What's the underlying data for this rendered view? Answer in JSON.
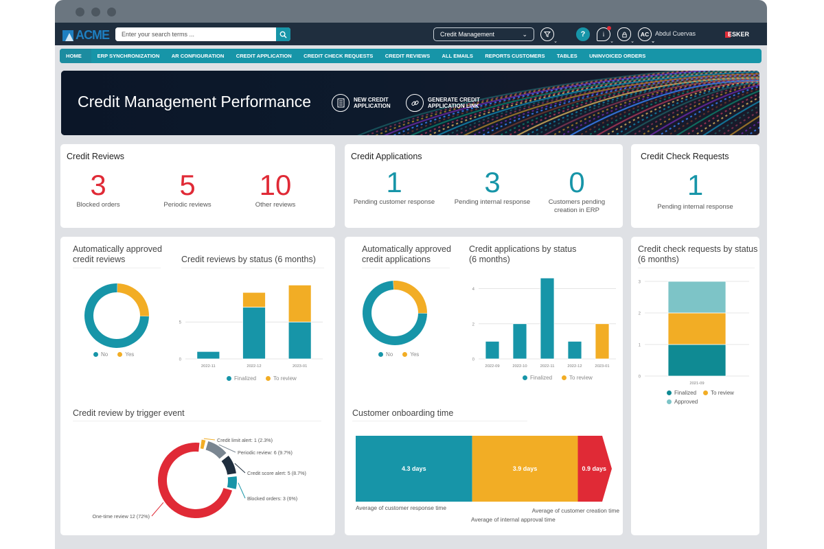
{
  "window": {
    "controls": [
      "close",
      "minimize",
      "maximize"
    ]
  },
  "topbar": {
    "logo_text": "ACME",
    "search": {
      "placeholder": "Enter your search terms ...",
      "value": ""
    },
    "module_select": {
      "selected": "Credit Management"
    },
    "user": {
      "initials": "AC",
      "name": "Abdul Cuervas"
    },
    "brand": "ESKER",
    "help_label": "?"
  },
  "nav": {
    "items": [
      {
        "label": "HOME",
        "active": true
      },
      {
        "label": "ERP SYNCHRONIZATION"
      },
      {
        "label": "AR CONFIGURATION"
      },
      {
        "label": "CREDIT APPLICATION"
      },
      {
        "label": "CREDIT CHECK REQUESTS"
      },
      {
        "label": "CREDIT REVIEWS"
      },
      {
        "label": "ALL EMAILS"
      },
      {
        "label": "REPORTS CUSTOMERS"
      },
      {
        "label": "TABLES"
      },
      {
        "label": "UNINVOICED ORDERS"
      }
    ]
  },
  "hero": {
    "title": "Credit Management Performance",
    "actions": [
      {
        "label_line1": "NEW CREDIT",
        "label_line2": "APPLICATION"
      },
      {
        "label_line1": "GENERATE CREDIT",
        "label_line2": "APPLICATION LINK"
      }
    ]
  },
  "colors": {
    "teal": "#1795a8",
    "red": "#e02a36",
    "yellow": "#f2ad25",
    "light_teal": "#7dc4c7",
    "dark": "#1f2e3e",
    "grey": "#7a8691"
  },
  "kpis": {
    "credit_reviews": {
      "title": "Credit Reviews",
      "items": [
        {
          "value": "3",
          "label": "Blocked orders"
        },
        {
          "value": "5",
          "label": "Periodic reviews"
        },
        {
          "value": "10",
          "label": "Other reviews"
        }
      ]
    },
    "credit_applications": {
      "title": "Credit Applications",
      "items": [
        {
          "value": "1",
          "label": "Pending customer response"
        },
        {
          "value": "3",
          "label": "Pending internal response"
        },
        {
          "value": "0",
          "label": "Customers pending creation in ERP"
        }
      ]
    },
    "credit_check_requests": {
      "title": "Credit Check Requests",
      "items": [
        {
          "value": "1",
          "label": "Pending internal response"
        }
      ]
    }
  },
  "chart_data": [
    {
      "id": "auto_approved_reviews",
      "type": "pie",
      "title": "Automatically approved credit reviews",
      "categories": [
        "No",
        "Yes"
      ],
      "values": [
        75,
        25
      ],
      "donut": true,
      "legend": "bottom"
    },
    {
      "id": "reviews_by_status",
      "type": "bar",
      "stacked": true,
      "title": "Credit reviews by status (6 months)",
      "categories": [
        "2022-11",
        "2022-12",
        "2023-01"
      ],
      "series": [
        {
          "name": "Finalized",
          "values": [
            1,
            7,
            5
          ]
        },
        {
          "name": "To review",
          "values": [
            0,
            2,
            5
          ]
        }
      ],
      "yticks": [
        0,
        5
      ],
      "ylim": [
        0,
        10.5
      ],
      "grid": true,
      "legend": "bottom"
    },
    {
      "id": "auto_approved_applications",
      "type": "pie",
      "title": "Automatically approved credit applications",
      "categories": [
        "No",
        "Yes"
      ],
      "values": [
        74,
        26
      ],
      "donut": true,
      "legend": "bottom"
    },
    {
      "id": "applications_by_status",
      "type": "bar",
      "stacked": true,
      "title": "Credit applications by status (6 months)",
      "categories": [
        "2022-09",
        "2022-10",
        "2022-11",
        "2022-12",
        "2023-01"
      ],
      "series": [
        {
          "name": "Finalized",
          "values": [
            1,
            2,
            4.6,
            1,
            0
          ]
        },
        {
          "name": "To review",
          "values": [
            0,
            0,
            0,
            0,
            2
          ]
        }
      ],
      "yticks": [
        0,
        2,
        4
      ],
      "ylim": [
        0,
        4.8
      ],
      "grid": true,
      "legend": "bottom"
    },
    {
      "id": "check_requests_by_status",
      "type": "bar",
      "stacked": true,
      "title": "Credit check requests by status (6 months)",
      "categories": [
        "2021-09"
      ],
      "series": [
        {
          "name": "Finalized",
          "values": [
            1
          ]
        },
        {
          "name": "To review",
          "values": [
            1
          ]
        },
        {
          "name": "Approved",
          "values": [
            1
          ]
        }
      ],
      "yticks": [
        0,
        1,
        2,
        3
      ],
      "ylim": [
        0,
        3
      ],
      "grid": true,
      "legend": "bottom"
    },
    {
      "id": "review_by_trigger",
      "type": "pie",
      "donut": true,
      "title": "Credit review by trigger event",
      "categories": [
        "Credit limit alert",
        "Periodic review",
        "Credit score alert",
        "Blocked orders",
        "One-time review"
      ],
      "values": [
        2.3,
        9.7,
        8.7,
        6,
        72
      ],
      "labels": [
        "Credit limit alert: 1 (2.3%)",
        "Periodic review: 6 (9.7%)",
        "Credit score alert: 5 (8.7%)",
        "Blocked orders: 3 (6%)",
        "One-time review 12 (72%)"
      ]
    },
    {
      "id": "onboarding_time",
      "type": "bar",
      "orientation": "horizontal-stacked",
      "title": "Customer onboarding time",
      "unit": "days",
      "categories": [
        "Average of customer response time",
        "Average of internal approval time",
        "Average of customer creation time"
      ],
      "values": [
        4.3,
        3.9,
        0.9
      ],
      "labels": [
        "4.3 days",
        "3.9 days",
        "0.9 days"
      ]
    }
  ]
}
